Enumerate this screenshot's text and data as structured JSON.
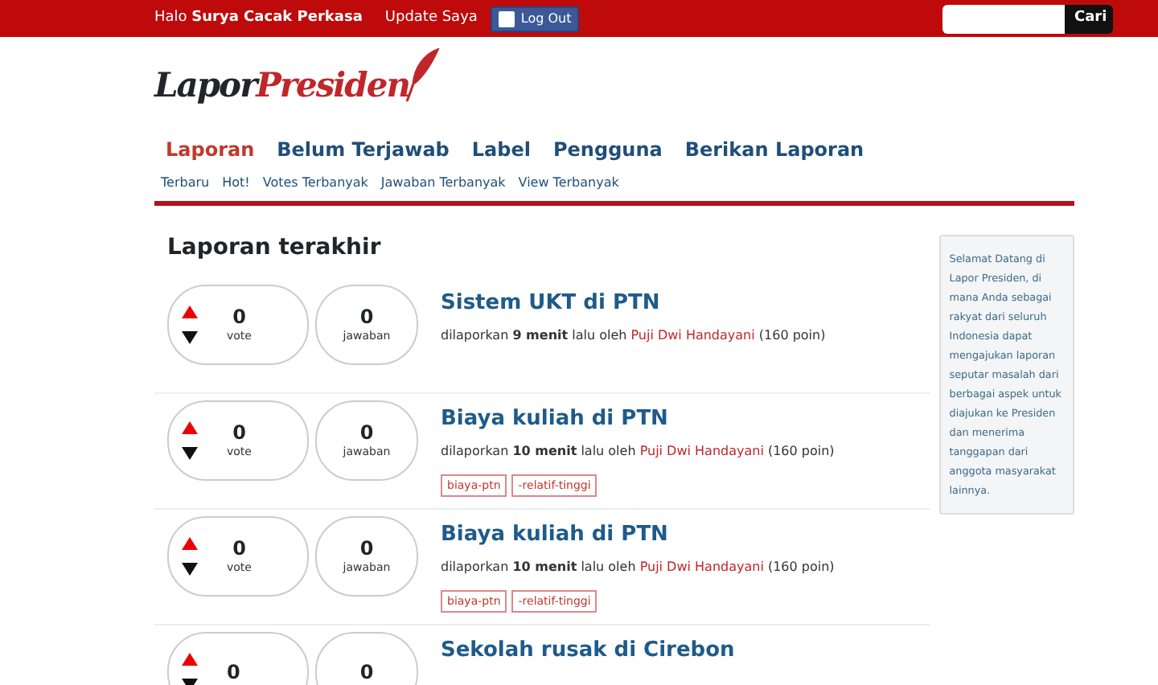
{
  "topbar": {
    "greeting": "Halo",
    "user": "Surya Cacak Perkasa",
    "update_link": "Update Saya",
    "logout_button": "Log Out",
    "search_button": "Cari"
  },
  "logo": {
    "part_1": "Lapor",
    "part_2": "Presiden"
  },
  "nav": [
    {
      "label": "Laporan",
      "selected": true
    },
    {
      "label": "Belum Terjawab",
      "selected": false
    },
    {
      "label": "Label",
      "selected": false
    },
    {
      "label": "Pengguna",
      "selected": false
    },
    {
      "label": "Berikan Laporan",
      "selected": false
    }
  ],
  "subnav": [
    "Terbaru",
    "Hot!",
    "Votes Terbanyak",
    "Jawaban Terbanyak",
    "View Terbanyak"
  ],
  "heading": "Laporan terakhir",
  "reports": [
    {
      "votes": "0",
      "vote_label": "vote",
      "answers": "0",
      "answer_label": "jawaban",
      "title": "Sistem UKT di PTN",
      "meta": "dilaporkan **9 menit** lalu oleh",
      "author": "Puji Dwi Handayani",
      "points": "(160 poin)"
    },
    {
      "votes": "0",
      "vote_label": "vote",
      "answers": "0",
      "answer_label": "jawaban",
      "title": "Biaya kuliah di PTN",
      "meta": "dilaporkan **10 menit** lalu oleh",
      "author": "Puji Dwi Handayani",
      "points": "(160 poin)",
      "tags": [
        "biaya-ptn",
        "-relatif-tinggi"
      ]
    },
    {
      "votes": "0",
      "vote_label": "vote",
      "answers": "0",
      "answer_label": "jawaban",
      "title": "Biaya kuliah di PTN",
      "meta": "dilaporkan **10 menit** lalu oleh",
      "author": "Puji Dwi Handayani",
      "points": "(160 poin)",
      "tags": [
        "biaya-ptn",
        "-relatif-tinggi"
      ]
    },
    {
      "votes": "0",
      "answers": "0",
      "title": "Sekolah rusak di Cirebon"
    }
  ],
  "sidebar": {
    "text": "Selamat Datang di Lapor Presiden, di mana Anda sebagai rakyat dari seluruh Indonesia dapat mengajukan laporan seputar masalah dari berbagai aspek untuk diajukan ke Presiden dan menerima tanggapan dari anggota masyarakat lainnya."
  }
}
